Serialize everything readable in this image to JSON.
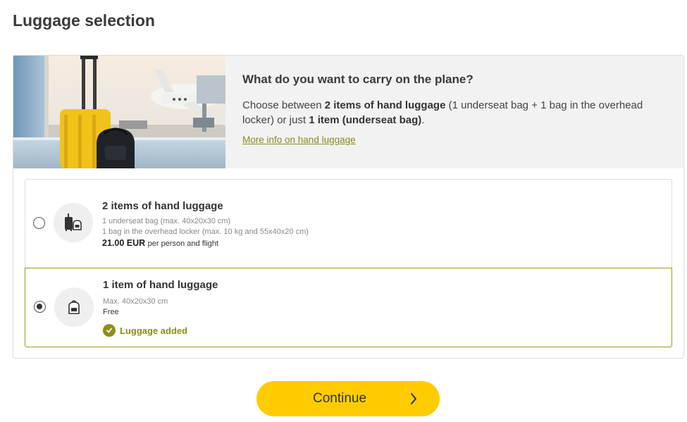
{
  "page": {
    "title": "Luggage selection"
  },
  "banner": {
    "heading": "What do you want to carry on the plane?",
    "desc_part1": "Choose between ",
    "desc_bold1": "2 items of hand luggage",
    "desc_part2": " (1 underseat bag + 1 bag in the overhead locker) or just ",
    "desc_bold2": "1 item (underseat bag)",
    "desc_part3": ".",
    "link": " More info on hand luggage"
  },
  "options": [
    {
      "title": "2 items of hand luggage",
      "detail1": "1 underseat bag (max. 40x20x30 cm)",
      "detail2": "1 bag in the overhead locker (max. 10 kg and 55x40x20 cm)",
      "price": "21.00 EUR",
      "price_suffix": "per person and flight",
      "selected": false,
      "icon": "suitcase-and-backpack-icon"
    },
    {
      "title": "1 item of hand luggage",
      "detail1": "Max. 40x20x30 cm",
      "price_text": "Free",
      "status": "Luggage added",
      "selected": true,
      "icon": "backpack-icon"
    }
  ],
  "continue": {
    "label": "Continue"
  },
  "colors": {
    "accent": "#ffcc00",
    "selected_border": "#9c9c1e",
    "link": "#8b8b18"
  }
}
